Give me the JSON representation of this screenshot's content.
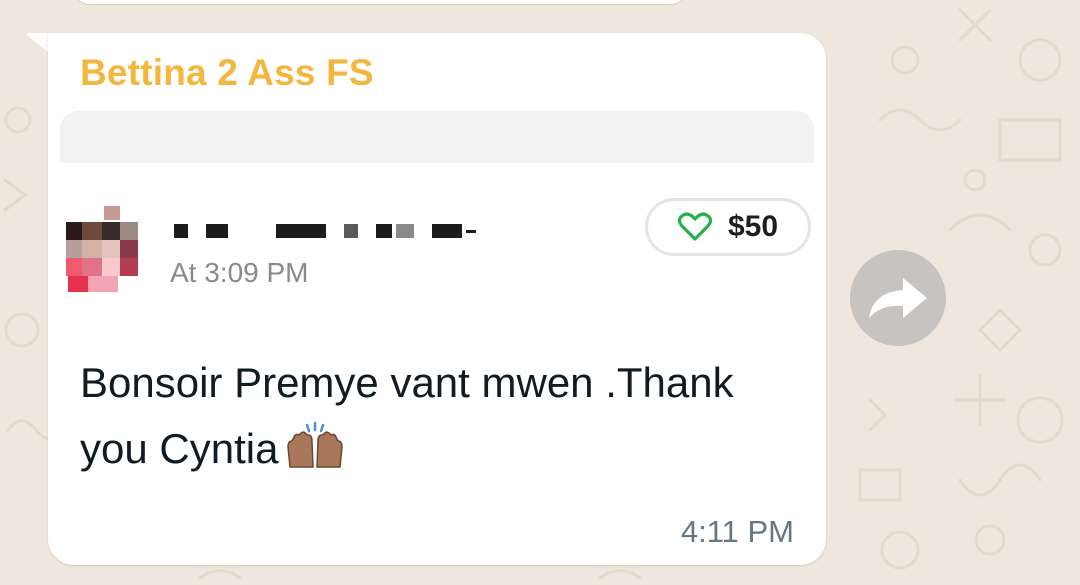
{
  "chat": {
    "sender_name": "Bettina 2 Ass FS",
    "quoted": {
      "time": "At 3:09 PM",
      "tip_amount": "$50",
      "tip_icon": "heart-icon"
    },
    "message_text": "Bonsoir Premye vant mwen .Thank you Cyntia",
    "message_emoji": "raising-hands-emoji",
    "message_time": "4:11 PM"
  },
  "actions": {
    "forward_icon": "forward-arrow-icon"
  },
  "colors": {
    "sender": "#f4b63d",
    "heart": "#25b04a",
    "chat_background": "#efe7dd",
    "bubble": "#ffffff"
  }
}
